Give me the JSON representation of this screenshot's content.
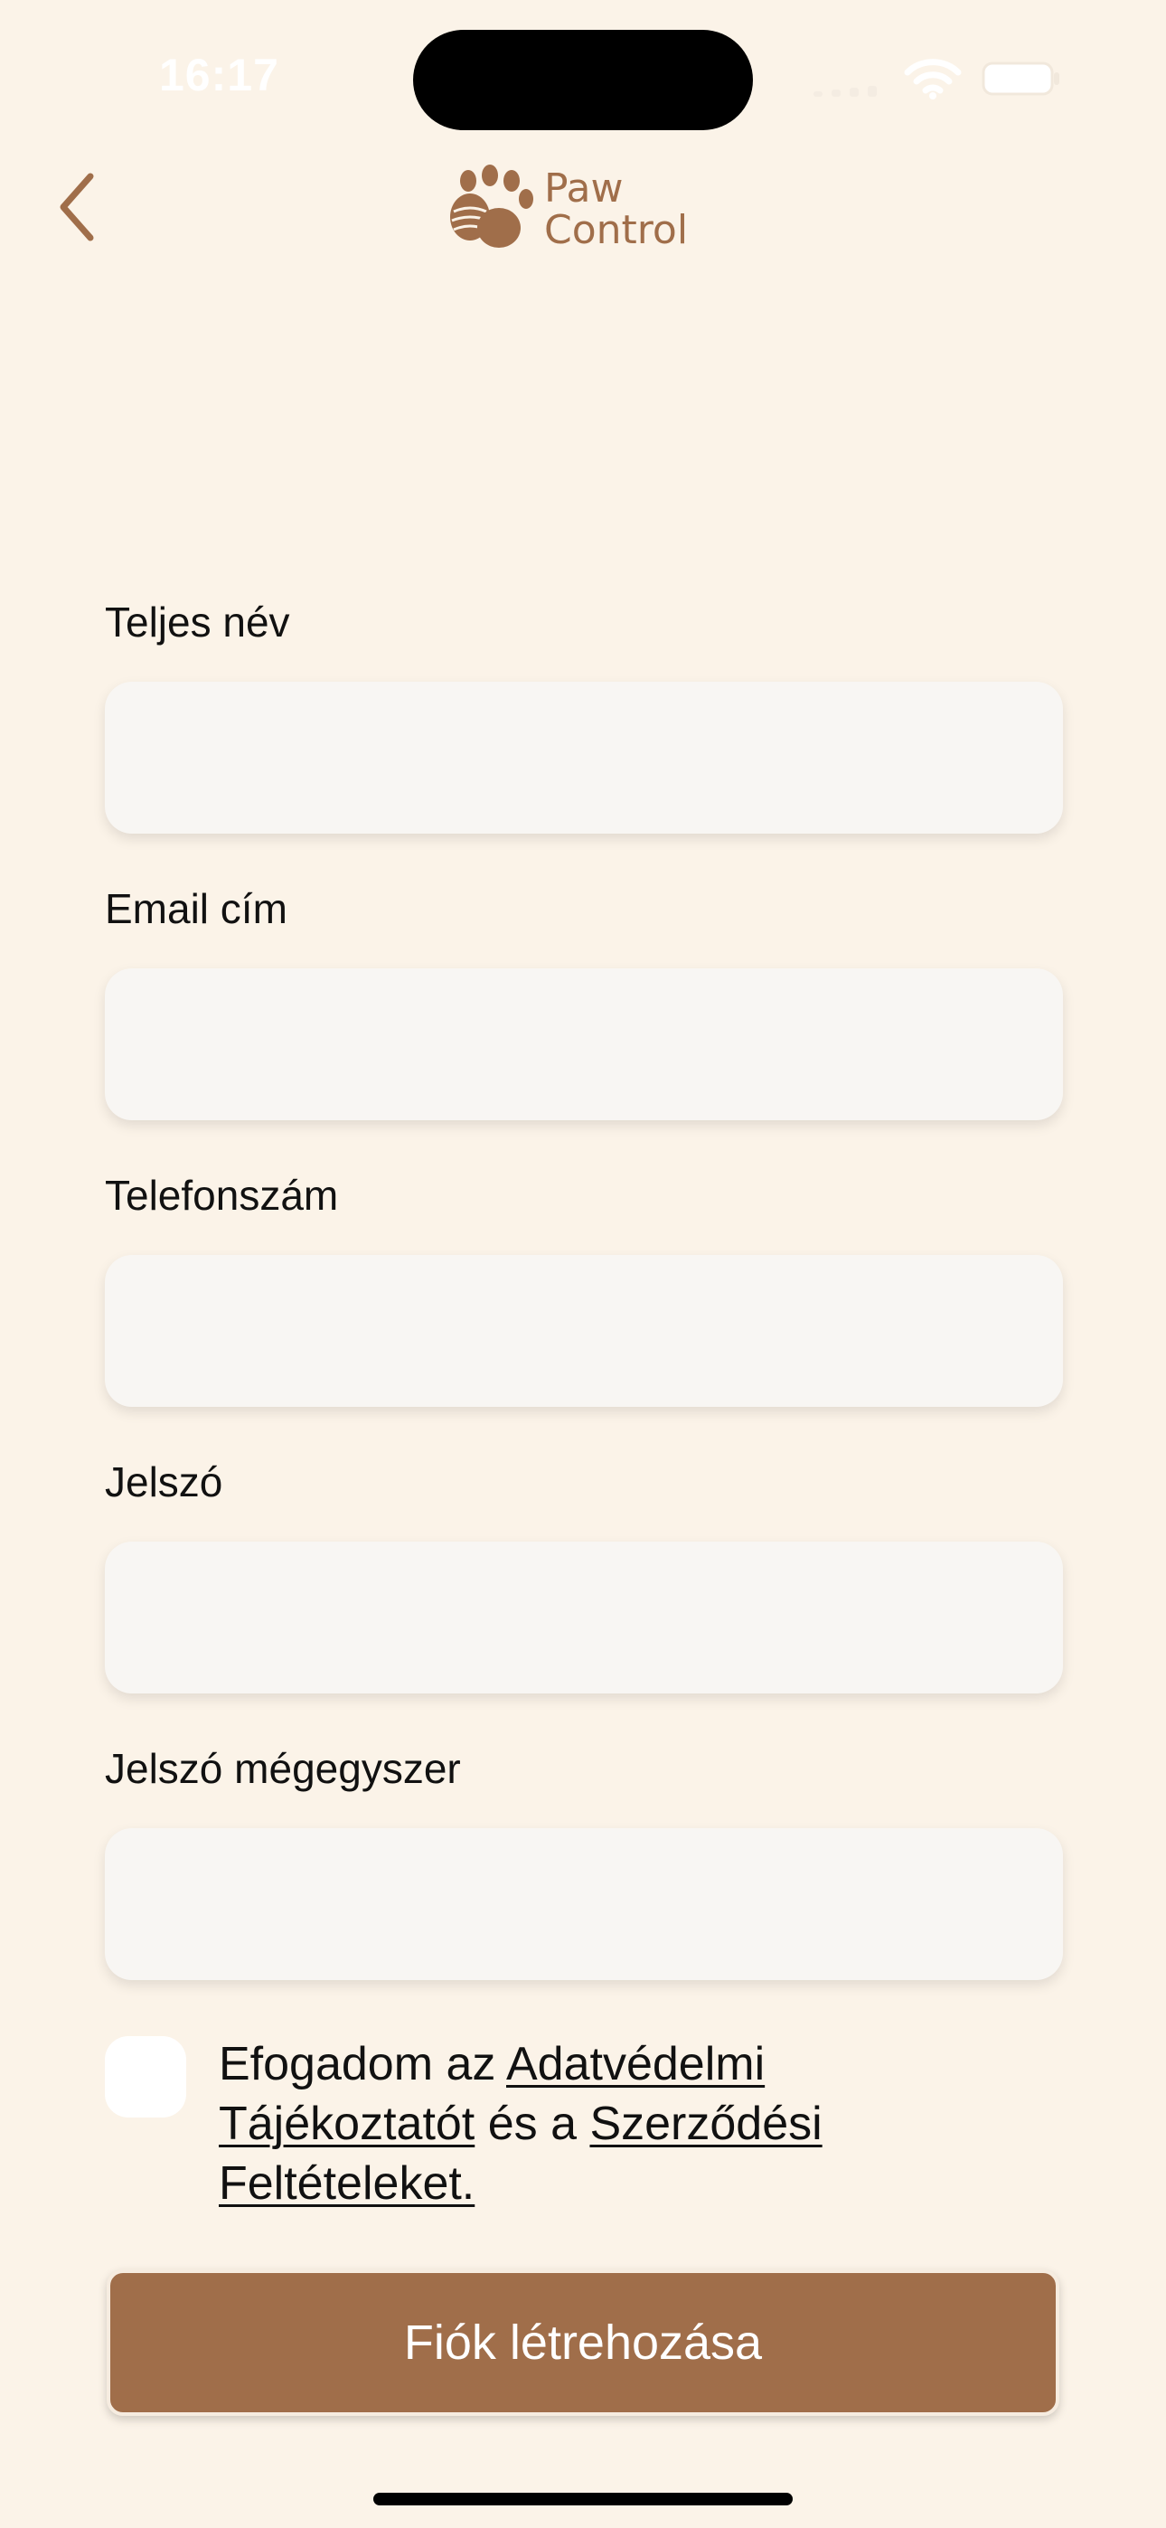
{
  "status_bar": {
    "time": "16:17"
  },
  "nav": {
    "back_icon": "chevron-left-icon",
    "logo_line1": "Paw",
    "logo_line2": "Control"
  },
  "form": {
    "full_name": {
      "label": "Teljes név",
      "value": "",
      "placeholder": ""
    },
    "email": {
      "label": "Email cím",
      "value": "",
      "placeholder": ""
    },
    "phone": {
      "label": "Telefonszám",
      "value": "",
      "placeholder": ""
    },
    "password": {
      "label": "Jelszó",
      "value": "",
      "placeholder": ""
    },
    "password_again": {
      "label": "Jelszó mégegyszer",
      "value": "",
      "placeholder": ""
    }
  },
  "consent": {
    "checked": false,
    "text_before": "Efogadom az ",
    "privacy_link": "Adatvédelmi Tájékoztatót",
    "text_middle": " és a ",
    "terms_link": "Szerződési Feltételeket."
  },
  "actions": {
    "create_account_label": "Fiók létrehozása"
  },
  "colors": {
    "background": "#fbf3e8",
    "brand": "#a06e4a",
    "input_background": "#f8f6f3"
  }
}
